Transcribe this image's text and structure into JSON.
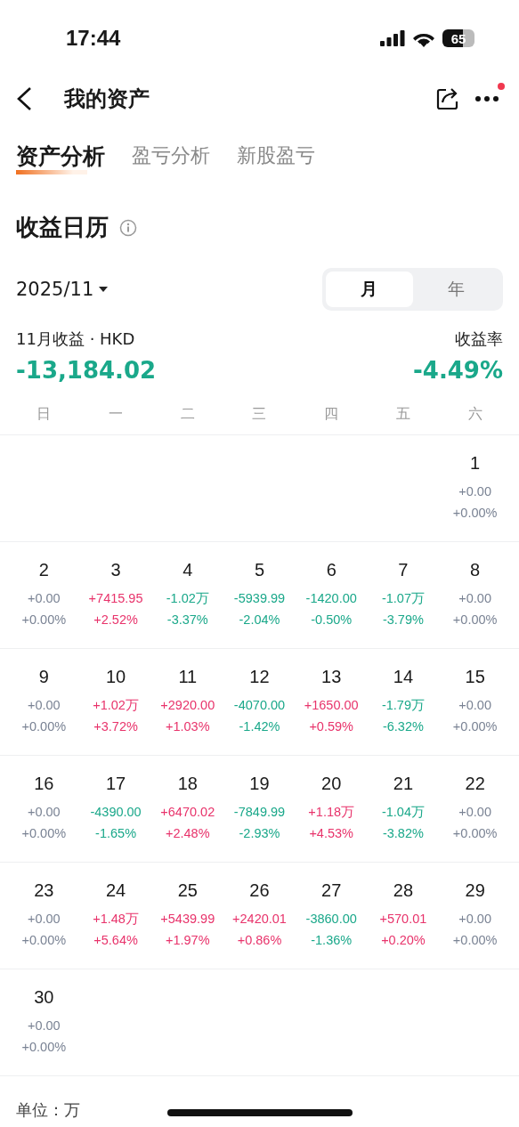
{
  "status_bar": {
    "time": "17:44",
    "battery": "65"
  },
  "nav": {
    "title": "我的资产",
    "has_notification": true
  },
  "tabs": [
    {
      "label": "资产分析",
      "selected": true
    },
    {
      "label": "盈亏分析",
      "selected": false
    },
    {
      "label": "新股盈亏",
      "selected": false
    }
  ],
  "section_title": "收益日历",
  "period": {
    "value": "2025/11",
    "options": [
      {
        "label": "月",
        "selected": true
      },
      {
        "label": "年",
        "selected": false
      }
    ]
  },
  "summary": {
    "label": "11月收益 · HKD",
    "value": "-13,184.02",
    "rate_label": "收益率",
    "rate": "-4.49%",
    "color": "#1aa88a"
  },
  "weekdays": [
    "日",
    "一",
    "二",
    "三",
    "四",
    "五",
    "六"
  ],
  "weeks": [
    [
      {
        "kind": "blank"
      },
      {
        "kind": "blank"
      },
      {
        "kind": "blank"
      },
      {
        "kind": "blank"
      },
      {
        "kind": "blank"
      },
      {
        "kind": "blank"
      },
      {
        "kind": "day",
        "day": "1",
        "value": "+0.00",
        "pct": "+0.00%",
        "color": "#7a8394"
      }
    ],
    [
      {
        "kind": "day",
        "day": "2",
        "value": "+0.00",
        "pct": "+0.00%",
        "color": "#7a8394"
      },
      {
        "kind": "day",
        "day": "3",
        "value": "+7415.95",
        "pct": "+2.52%",
        "color": "#e8336b"
      },
      {
        "kind": "day",
        "day": "4",
        "value": "-1.02万",
        "pct": "-3.37%",
        "color": "#1aa88a"
      },
      {
        "kind": "day",
        "day": "5",
        "value": "-5939.99",
        "pct": "-2.04%",
        "color": "#1aa88a"
      },
      {
        "kind": "day",
        "day": "6",
        "value": "-1420.00",
        "pct": "-0.50%",
        "color": "#1aa88a"
      },
      {
        "kind": "day",
        "day": "7",
        "value": "-1.07万",
        "pct": "-3.79%",
        "color": "#1aa88a"
      },
      {
        "kind": "day",
        "day": "8",
        "value": "+0.00",
        "pct": "+0.00%",
        "color": "#7a8394"
      }
    ],
    [
      {
        "kind": "day",
        "day": "9",
        "value": "+0.00",
        "pct": "+0.00%",
        "color": "#7a8394"
      },
      {
        "kind": "day",
        "day": "10",
        "value": "+1.02万",
        "pct": "+3.72%",
        "color": "#e8336b"
      },
      {
        "kind": "day",
        "day": "11",
        "value": "+2920.00",
        "pct": "+1.03%",
        "color": "#e8336b"
      },
      {
        "kind": "day",
        "day": "12",
        "value": "-4070.00",
        "pct": "-1.42%",
        "color": "#1aa88a"
      },
      {
        "kind": "day",
        "day": "13",
        "value": "+1650.00",
        "pct": "+0.59%",
        "color": "#e8336b"
      },
      {
        "kind": "day",
        "day": "14",
        "value": "-1.79万",
        "pct": "-6.32%",
        "color": "#1aa88a"
      },
      {
        "kind": "day",
        "day": "15",
        "value": "+0.00",
        "pct": "+0.00%",
        "color": "#7a8394"
      }
    ],
    [
      {
        "kind": "day",
        "day": "16",
        "value": "+0.00",
        "pct": "+0.00%",
        "color": "#7a8394"
      },
      {
        "kind": "day",
        "day": "17",
        "value": "-4390.00",
        "pct": "-1.65%",
        "color": "#1aa88a"
      },
      {
        "kind": "day",
        "day": "18",
        "value": "+6470.02",
        "pct": "+2.48%",
        "color": "#e8336b"
      },
      {
        "kind": "day",
        "day": "19",
        "value": "-7849.99",
        "pct": "-2.93%",
        "color": "#1aa88a"
      },
      {
        "kind": "day",
        "day": "20",
        "value": "+1.18万",
        "pct": "+4.53%",
        "color": "#e8336b"
      },
      {
        "kind": "day",
        "day": "21",
        "value": "-1.04万",
        "pct": "-3.82%",
        "color": "#1aa88a"
      },
      {
        "kind": "day",
        "day": "22",
        "value": "+0.00",
        "pct": "+0.00%",
        "color": "#7a8394"
      }
    ],
    [
      {
        "kind": "day",
        "day": "23",
        "value": "+0.00",
        "pct": "+0.00%",
        "color": "#7a8394"
      },
      {
        "kind": "day",
        "day": "24",
        "value": "+1.48万",
        "pct": "+5.64%",
        "color": "#e8336b"
      },
      {
        "kind": "day",
        "day": "25",
        "value": "+5439.99",
        "pct": "+1.97%",
        "color": "#e8336b"
      },
      {
        "kind": "day",
        "day": "26",
        "value": "+2420.01",
        "pct": "+0.86%",
        "color": "#e8336b"
      },
      {
        "kind": "day",
        "day": "27",
        "value": "-3860.00",
        "pct": "-1.36%",
        "color": "#1aa88a"
      },
      {
        "kind": "day",
        "day": "28",
        "value": "+570.01",
        "pct": "+0.20%",
        "color": "#e8336b"
      },
      {
        "kind": "day",
        "day": "29",
        "value": "+0.00",
        "pct": "+0.00%",
        "color": "#7a8394"
      }
    ],
    [
      {
        "kind": "day",
        "day": "30",
        "value": "+0.00",
        "pct": "+0.00%",
        "color": "#7a8394"
      }
    ]
  ],
  "unit_note": "单位：万"
}
